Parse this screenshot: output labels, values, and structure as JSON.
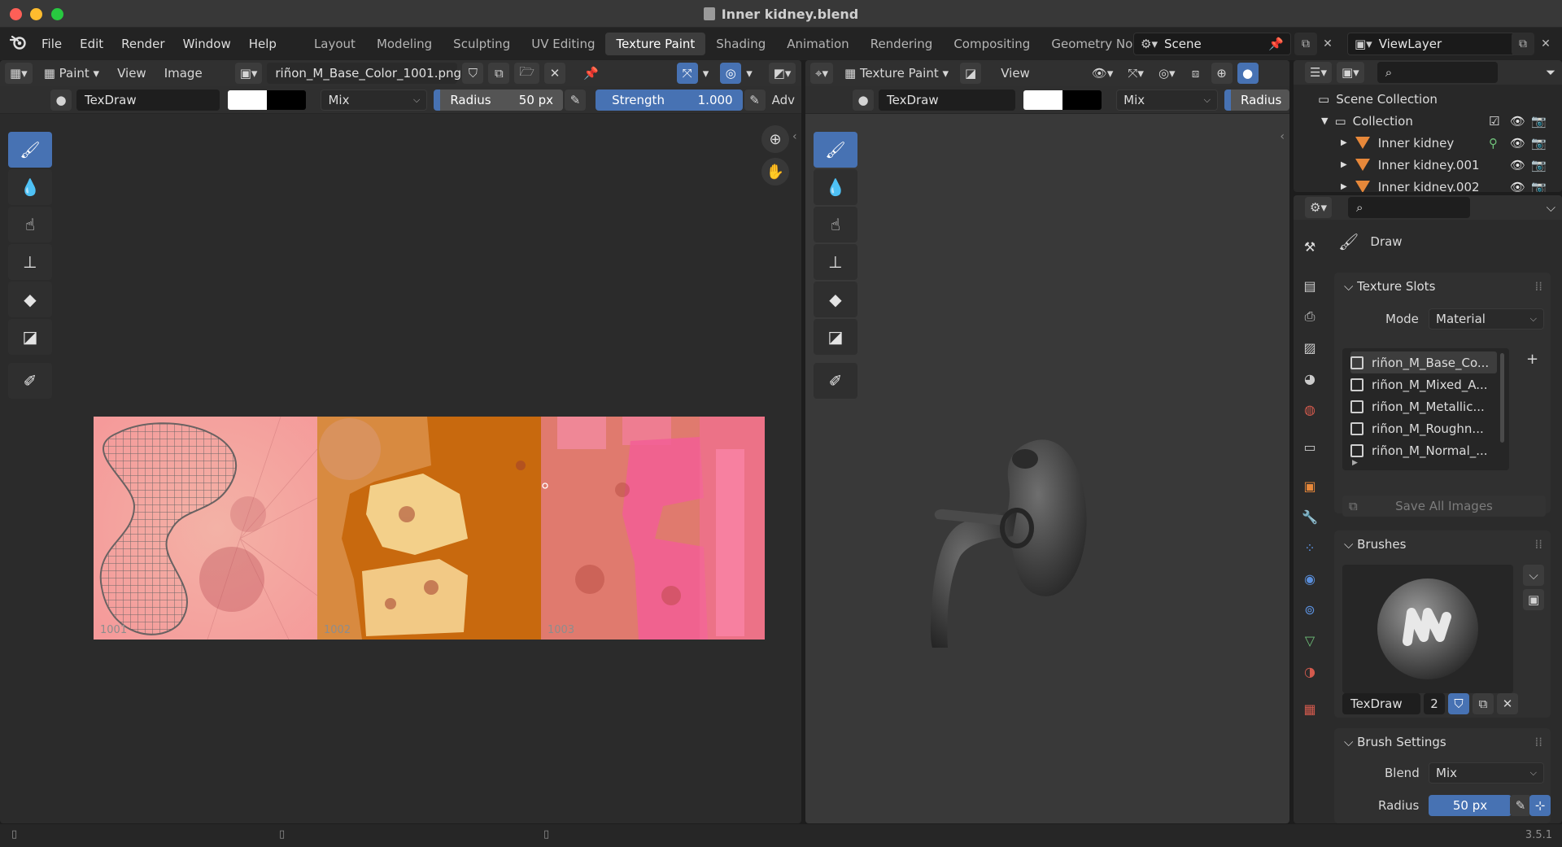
{
  "window": {
    "title": "Inner kidney.blend"
  },
  "menu": {
    "items": [
      "File",
      "Edit",
      "Render",
      "Window",
      "Help"
    ]
  },
  "workspaces": {
    "tabs": [
      "Layout",
      "Modeling",
      "Sculpting",
      "UV Editing",
      "Texture Paint",
      "Shading",
      "Animation",
      "Rendering",
      "Compositing",
      "Geometry Nodes"
    ],
    "active": "Texture Paint"
  },
  "scene": {
    "name": "Scene",
    "view_layer": "ViewLayer"
  },
  "image_editor": {
    "mode": "Paint",
    "menus": [
      "View",
      "Image"
    ],
    "image_name": "riñon_M_Base_Color_1001.png",
    "brush_name": "TexDraw",
    "blend_mode": "Mix",
    "radius_label": "Radius",
    "radius_value": "50 px",
    "strength_label": "Strength",
    "strength_value": "1.000",
    "advanced_label": "Adv",
    "tile_labels": [
      "1001",
      "1002",
      "1003"
    ],
    "colors": {
      "tile1": "#f5a0a0",
      "tile2": "#c8690e",
      "tile3": "#e87b72",
      "accent": "#4772b3"
    }
  },
  "viewport": {
    "mode": "Texture Paint",
    "menu": "View",
    "brush_name": "TexDraw",
    "blend_mode": "Mix",
    "radius_label": "Radius"
  },
  "outliner": {
    "root": "Scene Collection",
    "collection": "Collection",
    "objects": [
      "Inner kidney",
      "Inner kidney.001",
      "Inner kidney.002"
    ]
  },
  "properties": {
    "tool_name": "Draw",
    "texture_slots": {
      "title": "Texture Slots",
      "mode_label": "Mode",
      "mode_value": "Material",
      "slots": [
        "riñon_M_Base_Co...",
        "riñon_M_Mixed_A...",
        "riñon_M_Metallic...",
        "riñon_M_Roughn...",
        "riñon_M_Normal_..."
      ],
      "save_all": "Save All Images"
    },
    "brushes": {
      "title": "Brushes",
      "brush_name": "TexDraw",
      "users": "2"
    },
    "brush_settings": {
      "title": "Brush Settings",
      "blend_label": "Blend",
      "blend_value": "Mix",
      "radius_label": "Radius",
      "radius_value": "50 px"
    }
  },
  "status": {
    "version": "3.5.1"
  }
}
